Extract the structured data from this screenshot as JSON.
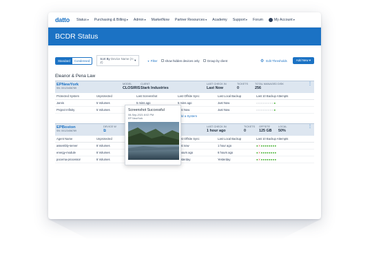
{
  "nav": {
    "logo": "datto",
    "items": [
      "Status",
      "Purchasing & Billing",
      "Admin",
      "MarketNow",
      "Partner Resources",
      "Academy",
      "Support",
      "Forum"
    ],
    "account": "My Account"
  },
  "banner": {
    "title": "BCDR Status"
  },
  "toolbar": {
    "standard": "Standard",
    "condensed": "Condensed",
    "sort_label": "Sort By",
    "sort_value": "Device Name (A-Z)",
    "filter": "Filter",
    "show_hidden": "show hidden devices only",
    "group_by": "Group by client",
    "thresholds": "Edit Thresholds",
    "add_new": "Add New"
  },
  "client": {
    "name": "Eleanor & Pena Law"
  },
  "devices": [
    {
      "name": "EPNewYork",
      "sn": "SN: 00123456789",
      "model_label": "MODEL",
      "model": "CLOSIRIS",
      "client_label": "CLIENT",
      "client": "Stark Industries",
      "checkin_label": "LAST CHECK IN",
      "checkin": "Last Now",
      "tickets_label": "TICKETS",
      "tickets": "0",
      "disk_label": "TOTAL MANAGED DISK",
      "disk": "256",
      "cols": [
        "Protected System",
        "Unprotected",
        "Last Screenshot",
        "Last Offsite Sync",
        "Last Local Backup",
        "Last 10 Backup Attempts"
      ],
      "rows": [
        {
          "system": "Jarvis",
          "unprotected": "5 Volumes",
          "screenshot": "5 mins ago",
          "offsite": "5 mins ago",
          "local": "Just Now"
        },
        {
          "system": "Project Infinity",
          "unprotected": "5 Volumes",
          "screenshot": "",
          "offsite": "Just Now",
          "local": "Just Now"
        }
      ],
      "add_system": "+ Add a System"
    },
    {
      "name": "EPBoston",
      "sn": "SN: 00123456789",
      "model_label": "DEVICE W",
      "checkin_label": "LAST CHECK IN",
      "checkin": "1 hour ago",
      "tickets_label": "TICKETS",
      "tickets": "0",
      "offsite_label": "OFFSITE",
      "offsite": "125 GB",
      "local_label": "LOCAL",
      "local": "50%",
      "cols": [
        "Agent Name",
        "Unprotected",
        "",
        "Last Offsite Sync",
        "Last Local Backup",
        "Last 10 Backup Attempts"
      ],
      "rows": [
        {
          "system": "assembly-server",
          "unprotected": "8 Volumes",
          "offsite": "Just now",
          "local": "1 hour ago"
        },
        {
          "system": "energy-module",
          "unprotected": "8 Volumes",
          "offsite": "6 hours ago",
          "local": "6 hours ago"
        },
        {
          "system": "pocerna-processor",
          "unprotected": "8 Volumes",
          "offsite": "Yesterday",
          "local": "Yesterday"
        }
      ]
    }
  ],
  "tooltip": {
    "title": "Screenshot Successful",
    "date": "08-Sep-2021 8:02 PM",
    "device": "EP NewYork"
  },
  "colors": {
    "brand": "#1b72c4",
    "success": "#3fae2a",
    "fail": "#e25a4d"
  }
}
